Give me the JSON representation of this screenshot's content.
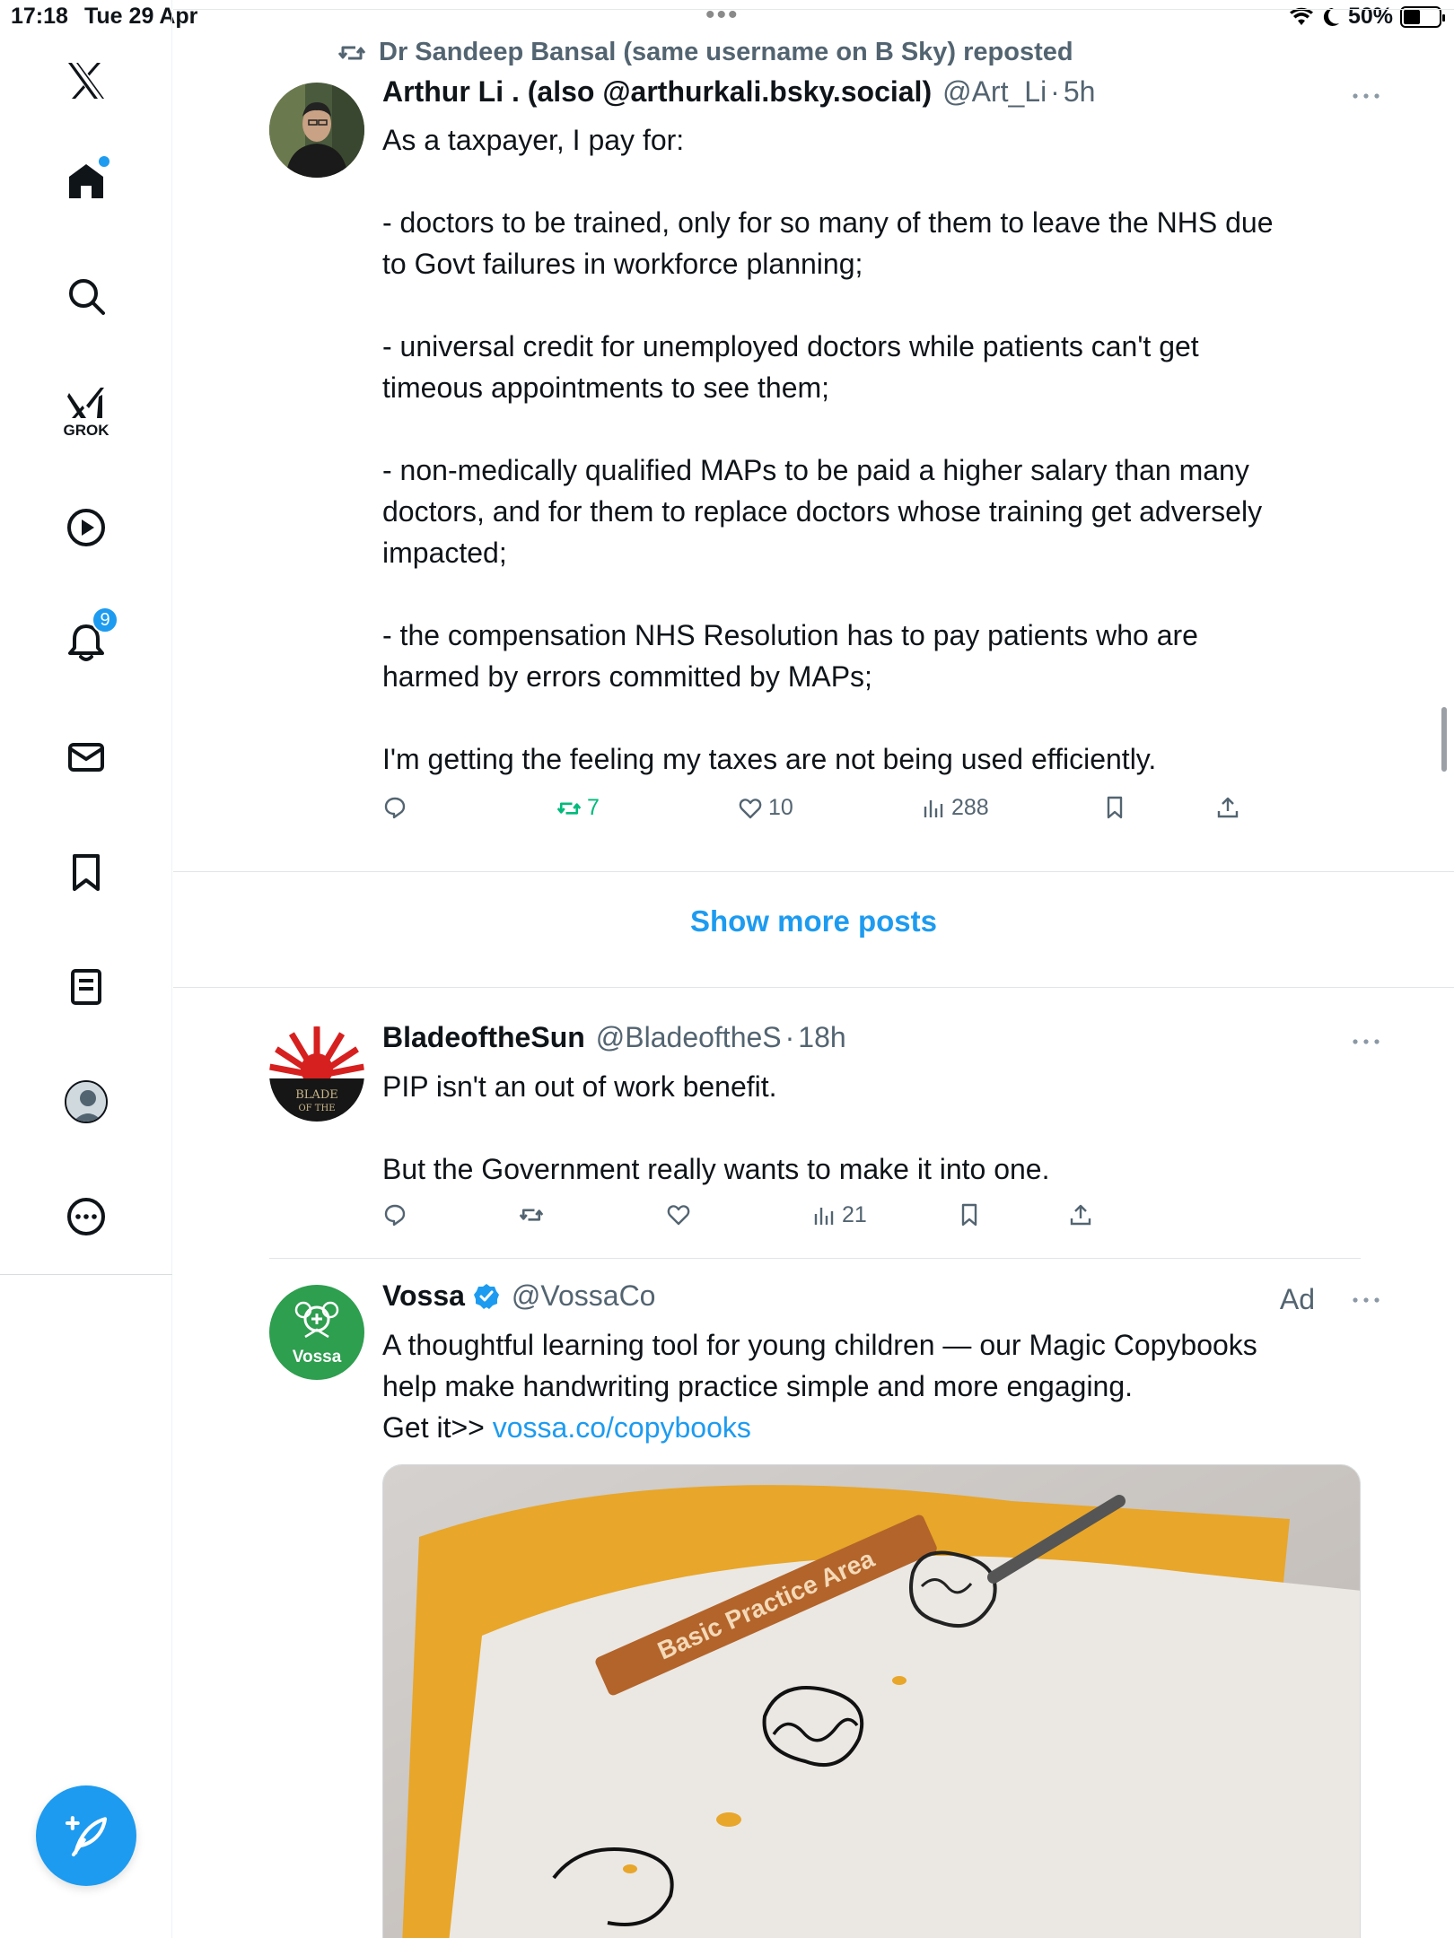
{
  "status_bar": {
    "time": "17:18",
    "date": "Tue 29 Apr",
    "battery": "50%"
  },
  "sidebar": {
    "grok_label": "GROK",
    "notification_count": "9",
    "items": [
      "x-logo",
      "home-icon",
      "search-icon",
      "grok-icon",
      "video-icon",
      "notifications-icon",
      "messages-icon",
      "bookmarks-icon",
      "lists-icon",
      "profile-icon",
      "more-icon"
    ]
  },
  "feed": {
    "repost_banner": "Dr Sandeep Bansal (same username on B Sky) reposted",
    "tweet1": {
      "name": "Arthur Li . (also @arthurkali.bsky.social)",
      "handle": "@Art_Li",
      "dot": "·",
      "time": "5h",
      "lines": [
        "As a taxpayer, I pay for:",
        "- doctors to be trained, only for so many of them to leave the NHS due",
        "to Govt failures in workforce planning;",
        "- universal credit for unemployed doctors while patients can't get",
        "timeous appointments to see them;",
        "- non-medically qualified MAPs to be paid a higher salary than many",
        "doctors, and for them to replace doctors whose training get adversely",
        "impacted;",
        "- the compensation NHS Resolution has to pay patients who are",
        "harmed by errors committed by MAPs;",
        "I'm getting the feeling my taxes are not being used efficiently."
      ],
      "reposts": "7",
      "likes": "10",
      "views": "288"
    },
    "show_more": "Show more posts",
    "tweet2": {
      "name": "BladeoftheSun",
      "handle": "@BladeoftheS",
      "dot": "·",
      "time": "18h",
      "avatar_text_1": "BLADE",
      "avatar_text_2": "OF THE",
      "lines": [
        "PIP isn't an out of work benefit.",
        "But the Government really wants to make it into one."
      ],
      "views": "21"
    },
    "tweet3": {
      "name": "Vossa",
      "handle": "@VossaCo",
      "ad_label": "Ad",
      "avatar_text": "Vossa",
      "lines": [
        "A thoughtful learning tool for young children — our Magic Copybooks",
        "help make handwriting practice simple and more engaging."
      ],
      "cta_prefix": "Get it>> ",
      "link": "vossa.co/copybooks",
      "media_text": "Basic Practice Area"
    }
  },
  "colors": {
    "accent": "#1d9bf0",
    "repost_green": "#00ba7c",
    "muted": "#536471",
    "text": "#0f1419",
    "vossa_green": "#2e9e4f"
  }
}
